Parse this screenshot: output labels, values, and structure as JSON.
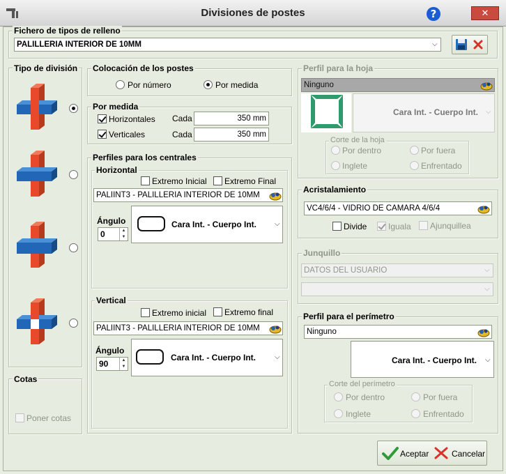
{
  "window": {
    "title": "Divisiones de postes",
    "help_label": "?",
    "close_label": "✕"
  },
  "fichero": {
    "legend": "Fichero de tipos de relleno",
    "value": "PALILLERIA INTERIOR DE 10MM"
  },
  "tipo_division": {
    "legend": "Tipo de división",
    "selected_index": 0
  },
  "colocacion": {
    "legend": "Colocación de los postes",
    "por_numero": "Por número",
    "por_medida": "Por medida"
  },
  "por_medida": {
    "legend": "Por medida",
    "horizontales": "Horizontales",
    "verticales": "Verticales",
    "cada": "Cada",
    "h_value": "350 mm",
    "v_value": "350 mm"
  },
  "perfiles_centrales": {
    "legend": "Perfiles para los centrales",
    "horizontal": {
      "legend": "Horizontal",
      "extremo_inicial": "Extremo Inicial",
      "extremo_final": "Extremo Final",
      "profile": "PALIINT3 - PALILLERIA INTERIOR DE 10MM",
      "angulo_label": "Ángulo",
      "angulo": "0",
      "cara": "Cara Int. - Cuerpo Int."
    },
    "vertical": {
      "legend": "Vertical",
      "extremo_inicial": "Extremo inicial",
      "extremo_final": "Extremo final",
      "profile": "PALIINT3 - PALILLERIA INTERIOR DE 10MM",
      "angulo_label": "Ángulo",
      "angulo": "90",
      "cara": "Cara Int. - Cuerpo Int."
    }
  },
  "cotas": {
    "legend": "Cotas",
    "poner_cotas": "Poner cotas"
  },
  "perfil_hoja": {
    "legend": "Perfil para la hoja",
    "value": "Ninguno",
    "cara": "Cara Int. - Cuerpo Int.",
    "corte_legend": "Corte de la hoja",
    "por_dentro": "Por dentro",
    "por_fuera": "Por fuera",
    "inglete": "Inglete",
    "enfrentado": "Enfrentado"
  },
  "acristalamiento": {
    "legend": "Acristalamiento",
    "value": "VC4/6/4 - VIDRIO DE CAMARA 4/6/4",
    "divide": "Divide",
    "iguala": "Iguala",
    "ajunquillea": "Ajunquillea"
  },
  "junquillo": {
    "legend": "Junquillo",
    "value": "DATOS DEL USUARIO",
    "value2": ""
  },
  "perfil_perimetro": {
    "legend": "Perfil para el perímetro",
    "value": "Ninguno",
    "cara": "Cara Int. - Cuerpo Int.",
    "corte_legend": "Corte del perímetro",
    "por_dentro": "Por dentro",
    "por_fuera": "Por fuera",
    "inglete": "Inglete",
    "enfrentado": "Enfrentado"
  },
  "buttons": {
    "aceptar": "Aceptar",
    "cancelar": "Cancelar"
  }
}
